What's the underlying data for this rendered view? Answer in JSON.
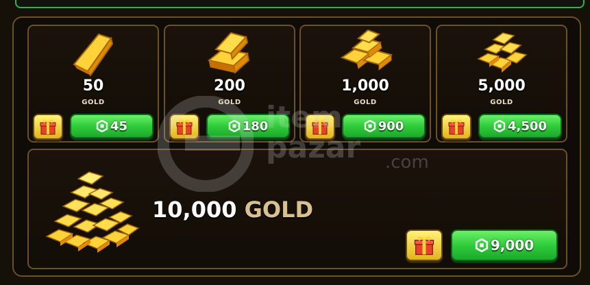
{
  "packs": [
    {
      "amount": "50",
      "unit": "GOLD",
      "price": "45"
    },
    {
      "amount": "200",
      "unit": "GOLD",
      "price": "180"
    },
    {
      "amount": "1,000",
      "unit": "GOLD",
      "price": "900"
    },
    {
      "amount": "5,000",
      "unit": "GOLD",
      "price": "4,500"
    }
  ],
  "featured": {
    "amount": "10,000",
    "unit": "GOLD",
    "price": "9,000"
  },
  "watermark": {
    "brand_top": "item",
    "brand_bottom": "pazar",
    "suffix": ".com"
  },
  "colors": {
    "gold": "#f6b51c",
    "buy_green": "#2fcc3a",
    "gift_yellow": "#f2d23a",
    "frame": "#6b5124"
  },
  "icons": {
    "currency": "robux-icon",
    "gift": "gift-icon"
  }
}
